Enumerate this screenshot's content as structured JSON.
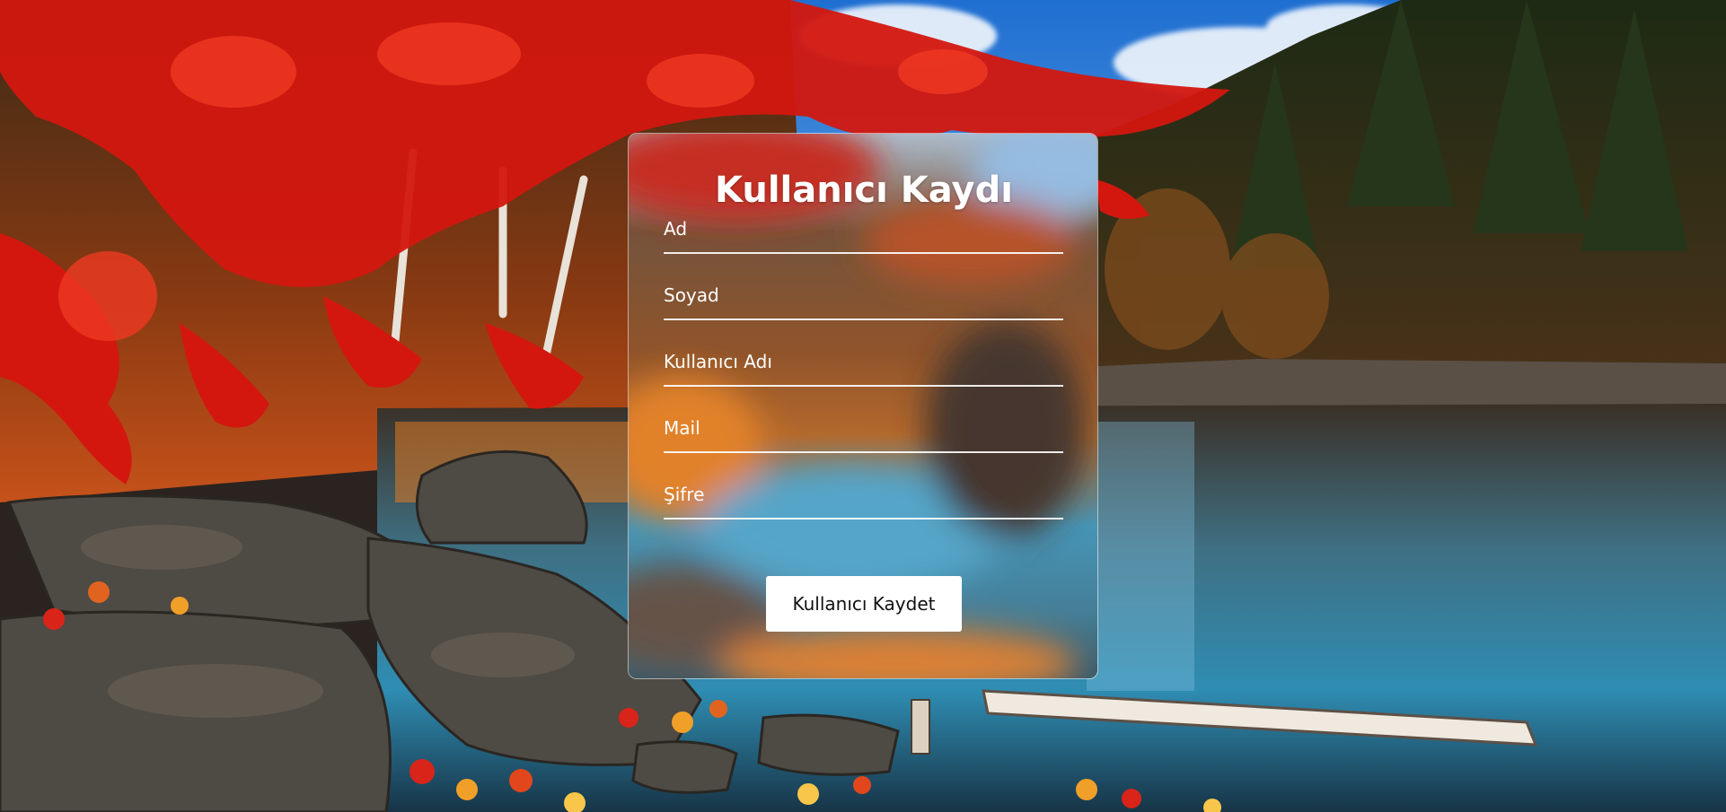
{
  "form": {
    "title": "Kullanıcı Kaydı",
    "fields": [
      {
        "placeholder": "Ad",
        "value": ""
      },
      {
        "placeholder": "Soyad",
        "value": ""
      },
      {
        "placeholder": "Kullanıcı Adı",
        "value": ""
      },
      {
        "placeholder": "Mail",
        "value": ""
      },
      {
        "placeholder": "Şifre",
        "value": ""
      }
    ],
    "submit_label": "Kullanıcı Kaydet"
  },
  "background": {
    "subject": "autumn forest lake with red maple leaves",
    "colors": {
      "sky": "#2f86d9",
      "water": "#2d6a86",
      "leaves": "#d11a12",
      "foliage": "#c8561a",
      "rocks": "#4a4038"
    }
  },
  "colors": {
    "text": "#ffffff",
    "button_bg": "#ffffff",
    "button_text": "#111111"
  }
}
